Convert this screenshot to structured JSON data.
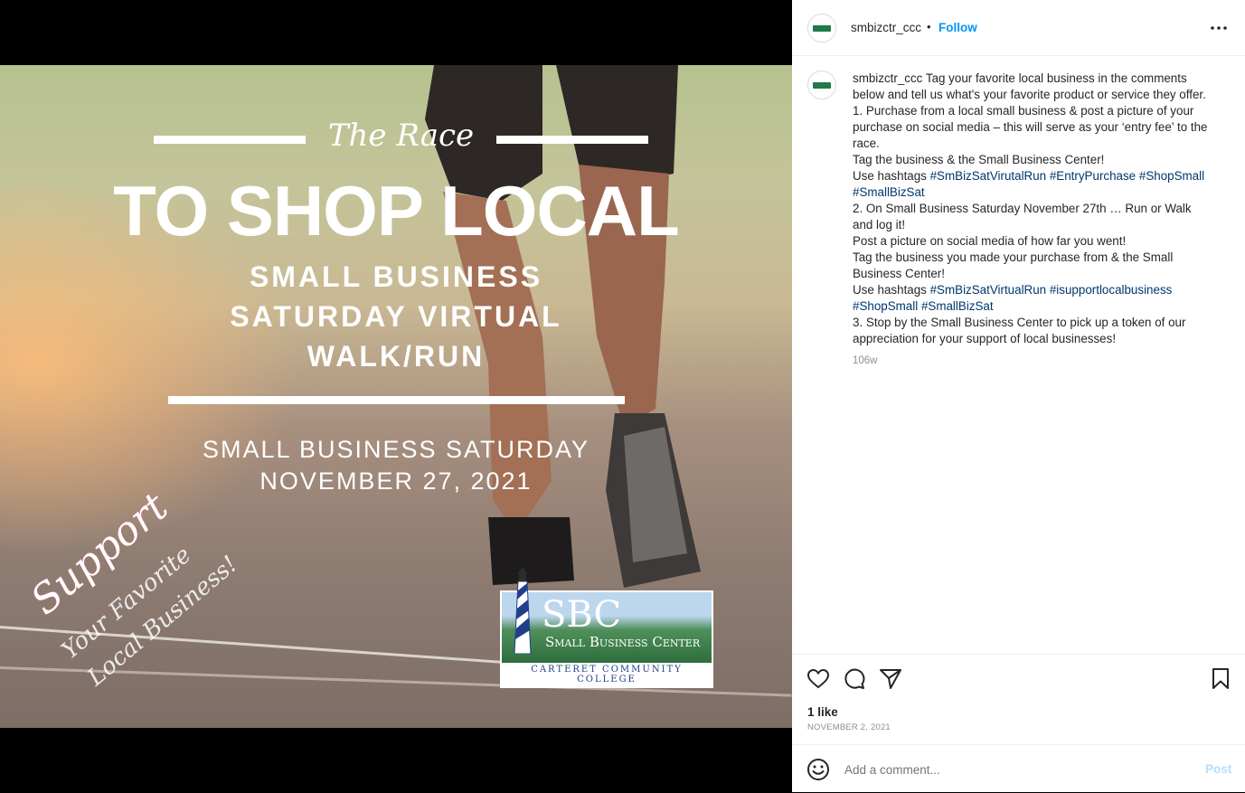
{
  "post_image": {
    "header_script": "The Race",
    "headline": "TO SHOP LOCAL",
    "subhead_lines": [
      "SMALL BUSINESS",
      "SATURDAY VIRTUAL",
      "WALK/RUN"
    ],
    "date_lines": [
      "SMALL BUSINESS SATURDAY",
      "NOVEMBER 27, 2021"
    ],
    "script_support": "Support",
    "script_lines": [
      "Your Favorite",
      "Local Business!"
    ],
    "logo": {
      "big": "SBC",
      "name": "Small Business Center",
      "college": "Carteret Community College"
    }
  },
  "header": {
    "username": "smbizctr_ccc",
    "separator": "•",
    "follow_label": "Follow",
    "more_icon": "more-horizontal-icon"
  },
  "caption": {
    "username": "smbizctr_ccc",
    "intro": "Tag your favorite local business in the comments below and tell us what's your favorite product or service they offer.",
    "p1": "1. Purchase from a local small business & post a picture of your purchase on social media – this will serve as your ‘entry fee’ to the race.",
    "p2": "Tag the business & the Small Business Center!",
    "p3_prefix": "Use hashtags ",
    "p3_tags": [
      "#SmBizSatVirutalRun",
      "#EntryPurchase",
      "#ShopSmall",
      "#SmallBizSat"
    ],
    "p4": "2. On Small Business Saturday November 27th … Run or Walk and log it!",
    "p5": "Post a picture on social media of how far you went!",
    "p6": "Tag the business you made your purchase from & the Small Business Center!",
    "p7_prefix": "Use hashtags ",
    "p7_tags": [
      "#SmBizSatVirtualRun",
      "#isupportlocalbusiness",
      "#ShopSmall",
      "#SmallBizSat"
    ],
    "p8": "3. Stop by the Small Business Center to pick up a token of our appreciation for your support of local businesses!",
    "age": "106w"
  },
  "actions": {
    "like_icon": "heart-icon",
    "comment_icon": "comment-icon",
    "share_icon": "send-icon",
    "save_icon": "bookmark-icon"
  },
  "likes": "1 like",
  "date": "NOVEMBER 2, 2021",
  "comment": {
    "placeholder": "Add a comment...",
    "post_label": "Post"
  },
  "colors": {
    "accent": "#0095f6",
    "tag": "#00376b",
    "muted": "#8e8e8e",
    "border": "#efefef"
  }
}
